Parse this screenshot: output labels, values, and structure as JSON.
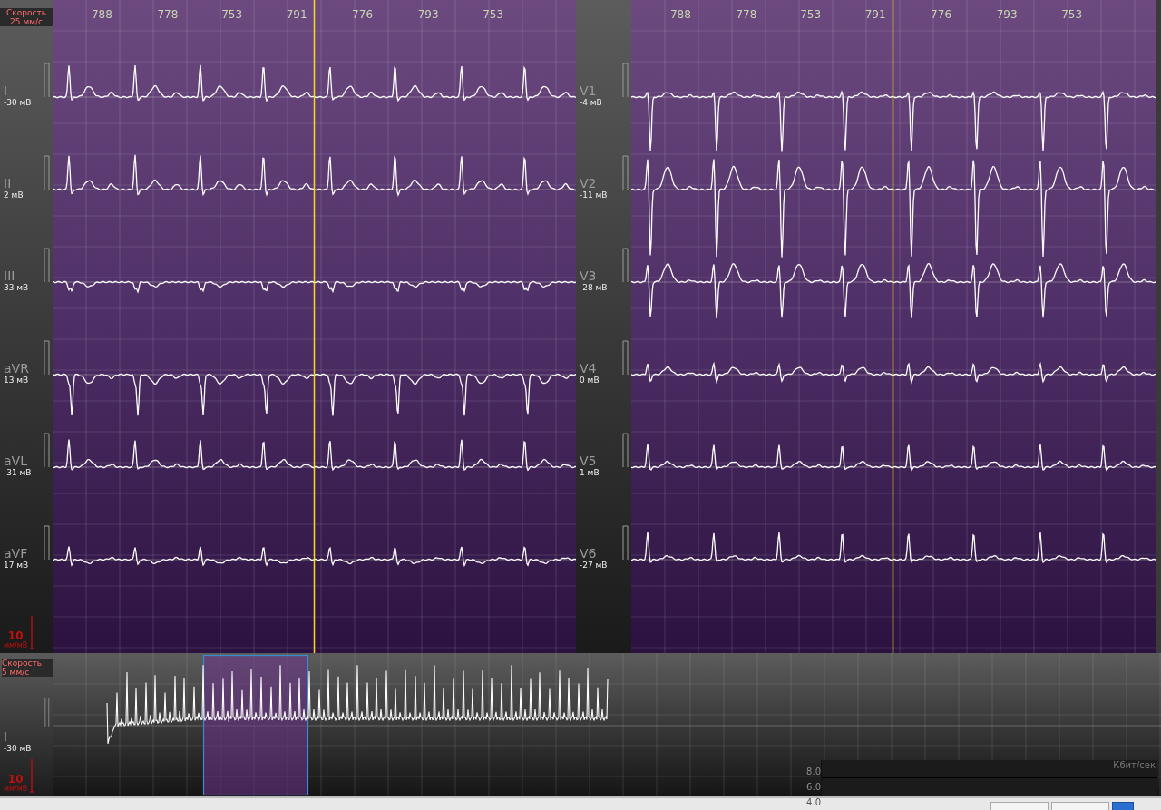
{
  "panels": [
    {
      "speed": {
        "label": "Скорость",
        "value": "25 мм/с"
      },
      "intervals": [
        "788",
        "778",
        "753",
        "791",
        "776",
        "793",
        "753"
      ],
      "leads": [
        {
          "name": "I",
          "offset": "-30 мВ"
        },
        {
          "name": "II",
          "offset": "2 мВ"
        },
        {
          "name": "III",
          "offset": "33 мВ"
        },
        {
          "name": "aVR",
          "offset": "13 мВ"
        },
        {
          "name": "aVL",
          "offset": "-31 мВ"
        },
        {
          "name": "aVF",
          "offset": "17 мВ"
        }
      ],
      "scale": {
        "value": "10",
        "unit": "мм/мВ"
      }
    },
    {
      "intervals": [
        "788",
        "778",
        "753",
        "791",
        "776",
        "793",
        "753"
      ],
      "leads": [
        {
          "name": "V1",
          "offset": "-4 мВ"
        },
        {
          "name": "V2",
          "offset": "-11 мВ"
        },
        {
          "name": "V3",
          "offset": "-28 мВ"
        },
        {
          "name": "V4",
          "offset": "0 мВ"
        },
        {
          "name": "V5",
          "offset": "1 мВ"
        },
        {
          "name": "V6",
          "offset": "-27 мВ"
        }
      ]
    }
  ],
  "overview": {
    "speed": {
      "label": "Скорость",
      "value": "5 мм/с"
    },
    "lead": {
      "name": "I",
      "offset": "-30 мВ"
    },
    "scale": {
      "value": "10",
      "unit": "мм/мВ"
    }
  },
  "bitrate": {
    "unit": "Кбит/сек",
    "ticks": [
      "8.0",
      "6.0",
      "4.0"
    ]
  }
}
